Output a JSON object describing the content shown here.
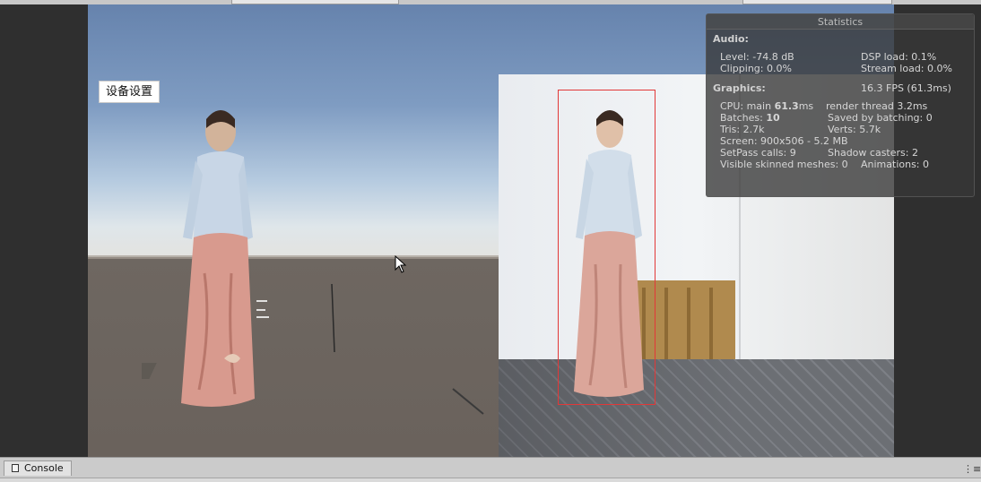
{
  "overlay": {
    "settings_button": "设备设置"
  },
  "statistics": {
    "title": "Statistics",
    "audio": {
      "heading": "Audio:",
      "level": "Level: -74.8 dB",
      "clipping": "Clipping: 0.0%",
      "dsp_load": "DSP load: 0.1%",
      "stream_load": "Stream load: 0.0%"
    },
    "graphics": {
      "heading": "Graphics:",
      "fps": "16.3 FPS (61.3ms)",
      "cpu_prefix": "CPU: main ",
      "cpu_main": "61.3",
      "cpu_suffix": "ms",
      "render_thread": "render thread 3.2ms",
      "batches_prefix": "Batches: ",
      "batches": "10",
      "saved_by_batching": "Saved by batching: 0",
      "tris": "Tris: 2.7k",
      "verts": "Verts: 5.7k",
      "screen": "Screen: 900x506 - 5.2 MB",
      "setpass": "SetPass calls: 9",
      "shadow_casters": "Shadow casters: 2",
      "skinned_meshes": "Visible skinned meshes: 0",
      "animations": "Animations: 0"
    }
  },
  "console": {
    "tab_label": "Console",
    "menu_icon": "menu-icon"
  },
  "colors": {
    "detection_box": "#e23838",
    "sky_top": "#6683ad",
    "ground": "#6e6761",
    "panel_bg": "#373737"
  }
}
